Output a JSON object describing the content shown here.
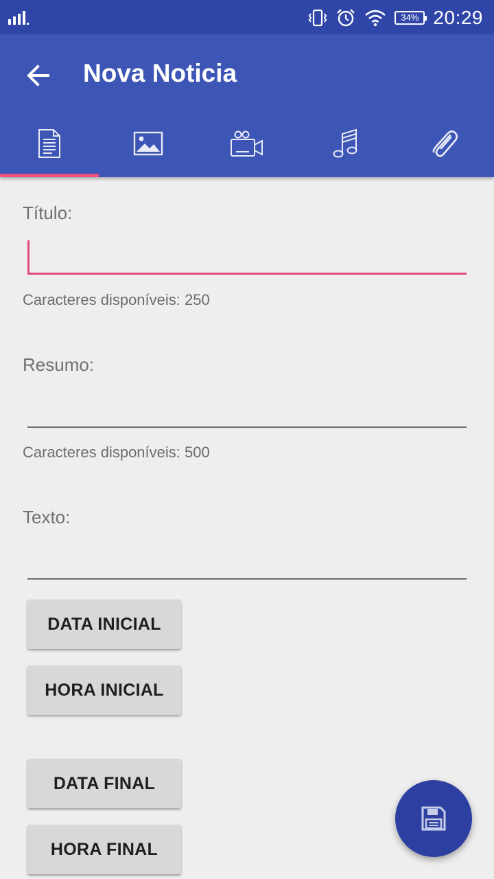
{
  "status_bar": {
    "battery": "34%",
    "time": "20:29",
    "icons": [
      "signal-icon",
      "vibrate-icon",
      "alarm-icon",
      "wifi-icon",
      "battery-icon"
    ]
  },
  "app_bar": {
    "title": "Nova Noticia",
    "back_icon": "arrow-left-icon",
    "tabs": [
      {
        "icon": "document-icon",
        "active": true
      },
      {
        "icon": "image-icon",
        "active": false
      },
      {
        "icon": "video-camera-icon",
        "active": false
      },
      {
        "icon": "music-icon",
        "active": false
      },
      {
        "icon": "attachment-icon",
        "active": false
      }
    ]
  },
  "form": {
    "titulo": {
      "label": "Título:",
      "value": "",
      "helper": "Caracteres disponíveis: 250"
    },
    "resumo": {
      "label": "Resumo:",
      "value": "",
      "helper": "Caracteres disponíveis: 500"
    },
    "texto": {
      "label": "Texto:",
      "value": ""
    },
    "buttons": {
      "data_inicial": "DATA INICIAL",
      "hora_inicial": "HORA INICIAL",
      "data_final": "DATA FINAL",
      "hora_final": "HORA FINAL"
    }
  },
  "fab": {
    "icon": "floppy-save-icon"
  },
  "colors": {
    "primary": "#3d55b5",
    "primary_dark": "#2f45a8",
    "accent": "#e4497a",
    "fab": "#2d40a1",
    "background": "#eeeeee"
  }
}
